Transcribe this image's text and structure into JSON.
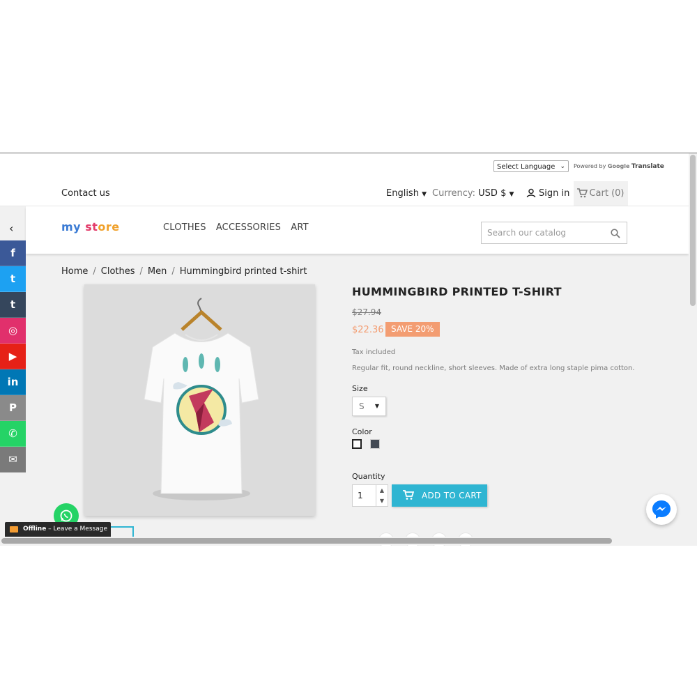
{
  "translate": {
    "select_label": "Select Language",
    "powered_by": "Powered by",
    "google": "Google",
    "translate": "Translate"
  },
  "header": {
    "contact": "Contact us",
    "language": "English",
    "currency_label": "Currency:",
    "currency_value": "USD $",
    "signin": "Sign in",
    "cart": "Cart (0)"
  },
  "nav": {
    "logo_parts": [
      "my",
      " ",
      "st",
      "ore"
    ],
    "menu": [
      "CLOTHES",
      "ACCESSORIES",
      "ART"
    ],
    "search_placeholder": "Search our catalog"
  },
  "social_buttons": [
    {
      "name": "facebook-icon",
      "glyph": "f",
      "color": "#3b5998"
    },
    {
      "name": "twitter-icon",
      "glyph": "t",
      "color": "#1da1f2"
    },
    {
      "name": "tumblr-icon",
      "glyph": "t",
      "color": "#35465c"
    },
    {
      "name": "instagram-icon",
      "glyph": "◎",
      "color": "#e1306c"
    },
    {
      "name": "youtube-icon",
      "glyph": "▶",
      "color": "#e62117"
    },
    {
      "name": "linkedin-icon",
      "glyph": "in",
      "color": "#0077b5"
    },
    {
      "name": "pinterest-icon",
      "glyph": "P",
      "color": "#8a8a8a"
    },
    {
      "name": "whatsapp-icon",
      "glyph": "✆",
      "color": "#25d366"
    },
    {
      "name": "email-icon",
      "glyph": "✉",
      "color": "#7a7a7a"
    }
  ],
  "breadcrumb": [
    "Home",
    "Clothes",
    "Men",
    "Hummingbird printed t-shirt"
  ],
  "product": {
    "title": "HUMMINGBIRD PRINTED T-SHIRT",
    "old_price": "$27.94",
    "new_price": "$22.36",
    "discount": "SAVE 20%",
    "tax": "Tax included",
    "description": "Regular fit, round neckline, short sleeves. Made of extra long staple pima cotton.",
    "size_label": "Size",
    "size_value": "S",
    "color_label": "Color",
    "colors": [
      "#ffffff",
      "#434a54"
    ],
    "quantity_label": "Quantity",
    "quantity": "1",
    "add_to_cart": "ADD TO CART"
  },
  "chat": {
    "status": "Offline",
    "message": "Leave a Message"
  },
  "colors": {
    "accent": "#2fb5d2",
    "price": "#f39d72"
  }
}
